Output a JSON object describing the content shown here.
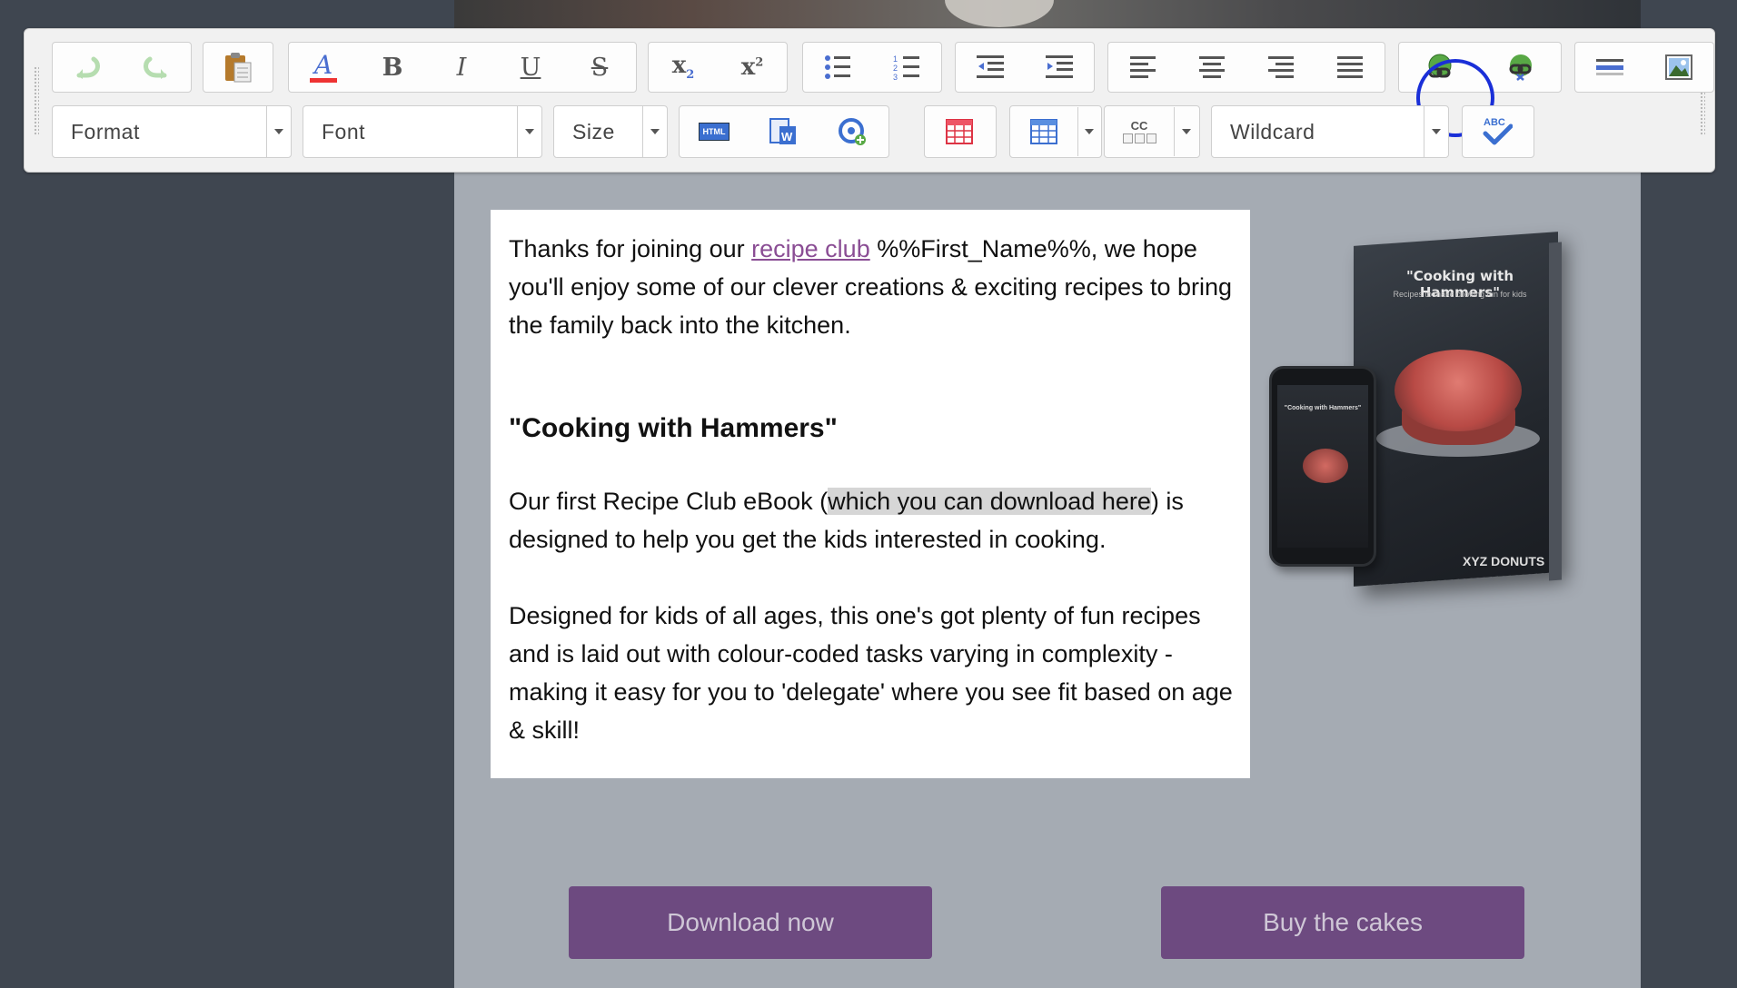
{
  "toolbar": {
    "format_label": "Format",
    "font_label": "Font",
    "size_label": "Size",
    "wildcard_label": "Wildcard",
    "subscript": {
      "base": "x",
      "sub": "2"
    },
    "superscript": {
      "base": "x",
      "sup": "2"
    },
    "spell_label": "ABC",
    "cc_label": "CC",
    "html_label": "HTML",
    "icons": [
      "undo-icon",
      "redo-icon",
      "paste-icon",
      "text-color-icon",
      "bold-icon",
      "italic-icon",
      "underline-icon",
      "strikethrough-icon",
      "subscript-icon",
      "superscript-icon",
      "bulleted-list-icon",
      "numbered-list-icon",
      "outdent-icon",
      "indent-icon",
      "align-left-icon",
      "align-center-icon",
      "align-right-icon",
      "justify-icon",
      "insert-link-icon",
      "remove-link-icon",
      "horizontal-rule-icon",
      "insert-image-icon",
      "html-source-icon",
      "paste-word-icon",
      "insert-tracking-icon",
      "insert-table-icon",
      "table-layout-icon",
      "cc-insert-icon",
      "spell-check-icon"
    ],
    "accent_ring_color": "#1a2fd8",
    "bold_glyph": "B",
    "italic_glyph": "I",
    "underline_glyph": "U",
    "strike_glyph": "S",
    "text_color_glyph": "A"
  },
  "content": {
    "intro_before_link": "Thanks for joining our ",
    "intro_link": "recipe club",
    "intro_after_link": " %%First_Name%%, we hope you'll enjoy some of our clever creations & exciting recipes to bring the family back into the kitchen.",
    "heading": "\"Cooking with Hammers\"",
    "para2_before": "Our first Recipe Club eBook (",
    "para2_selected": "which you can download here",
    "para2_after": ") is designed to help you get the kids interested in cooking.",
    "para3": "Designed for kids of all ages, this one's got plenty of fun recipes and is laid out with colour-coded tasks varying in complexity - making it easy for you to 'delegate' where you see fit based on age & skill!"
  },
  "mockup": {
    "book_title": "\"Cooking with Hammers\"",
    "book_subtitle": "Recipes to make cooking fun for kids",
    "phone_title": "\"Cooking with Hammers\"",
    "brand": "XYZ DONUTS"
  },
  "buttons": {
    "download": "Download now",
    "buy": "Buy the cakes"
  },
  "colors": {
    "link": "#8a4d94",
    "cta_bg": "#6d4a80",
    "selection": "#d6d6d6"
  }
}
